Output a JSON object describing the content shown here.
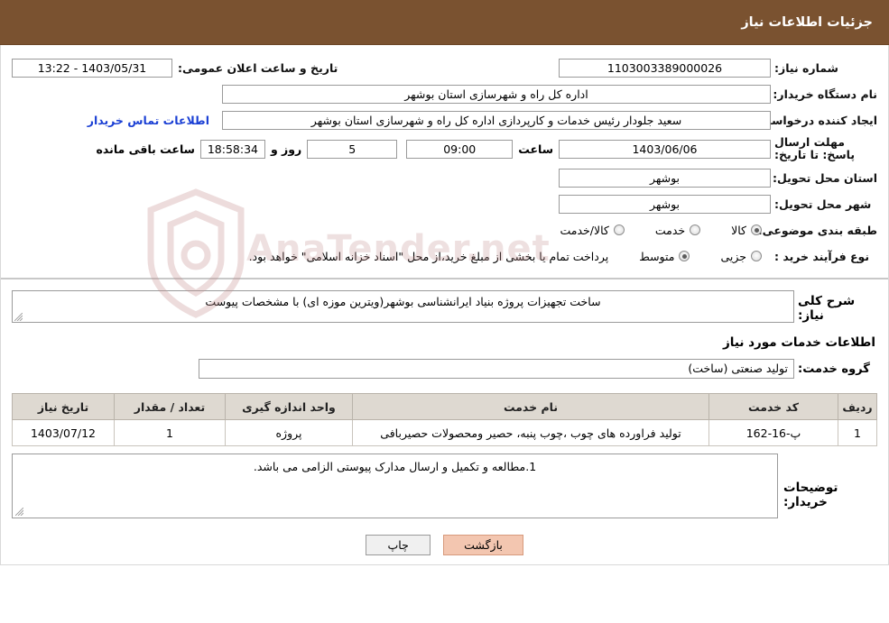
{
  "header": {
    "title": "جزئیات اطلاعات نیاز"
  },
  "info": {
    "need_number_label": "شماره نیاز:",
    "need_number_value": "1103003389000026",
    "public_announcement_label": "تاریخ و ساعت اعلان عمومی:",
    "public_announcement_value": "1403/05/31 - 13:22",
    "buyer_org_label": "نام دستگاه خریدار:",
    "buyer_org_value": "اداره کل راه و شهرسازی استان بوشهر",
    "creator_label": "ایجاد کننده درخواست:",
    "creator_value": "سعید جلودار رئیس خدمات و کارپردازی اداره کل راه و شهرسازی استان بوشهر",
    "contact_link": "اطلاعات تماس خریدار",
    "deadline_label": "مهلت ارسال پاسخ: تا تاریخ:",
    "deadline_date": "1403/06/06",
    "time_label": "ساعت",
    "deadline_time": "09:00",
    "days_value": "5",
    "days_label": "روز و",
    "remaining_time": "18:58:34",
    "remaining_label": "ساعت باقی مانده",
    "province_label": "استان محل تحویل:",
    "province_value": "بوشهر",
    "city_label": "شهر محل تحویل:",
    "city_value": "بوشهر",
    "category_label": "طبقه بندی موضوعی:",
    "category_options": [
      {
        "label": "کالا",
        "checked": true
      },
      {
        "label": "خدمت",
        "checked": false
      },
      {
        "label": "کالا/خدمت",
        "checked": false
      }
    ],
    "purchase_type_label": "نوع فرآیند خرید :",
    "purchase_type_options": [
      {
        "label": "جزیی",
        "checked": false
      },
      {
        "label": "متوسط",
        "checked": true
      }
    ],
    "purchase_note": "پرداخت تمام یا بخشی از مبلغ خرید،از محل \"اسناد خزانه اسلامی\" خواهد بود."
  },
  "description": {
    "label": "شرح کلی نیاز:",
    "value": "ساخت تجهیزات پروژه بنیاد ایرانشناسی بوشهر(ویترین موزه ای)  با مشخصات پیوست"
  },
  "services": {
    "heading": "اطلاعات خدمات مورد نیاز",
    "group_label": "گروه خدمت:",
    "group_value": "تولید صنعتی (ساخت)",
    "table": {
      "columns": [
        "ردیف",
        "کد خدمت",
        "نام خدمت",
        "واحد اندازه گیری",
        "تعداد / مقدار",
        "تاریخ نیاز"
      ],
      "rows": [
        {
          "index": "1",
          "code": "پ-16-162",
          "name": "تولید فراورده های چوب ،چوب پنبه، حصیر ومحصولات حصیربافی",
          "unit": "پروژه",
          "qty": "1",
          "date": "1403/07/12"
        }
      ]
    }
  },
  "buyer_notes": {
    "label": "توضیحات خریدار:",
    "value": "1.مطالعه و تکمیل و ارسال مدارک پیوستی الزامی می باشد."
  },
  "footer": {
    "print_label": "چاپ",
    "back_label": "بازگشت"
  },
  "watermark": {
    "text": "AnaTender.net"
  }
}
